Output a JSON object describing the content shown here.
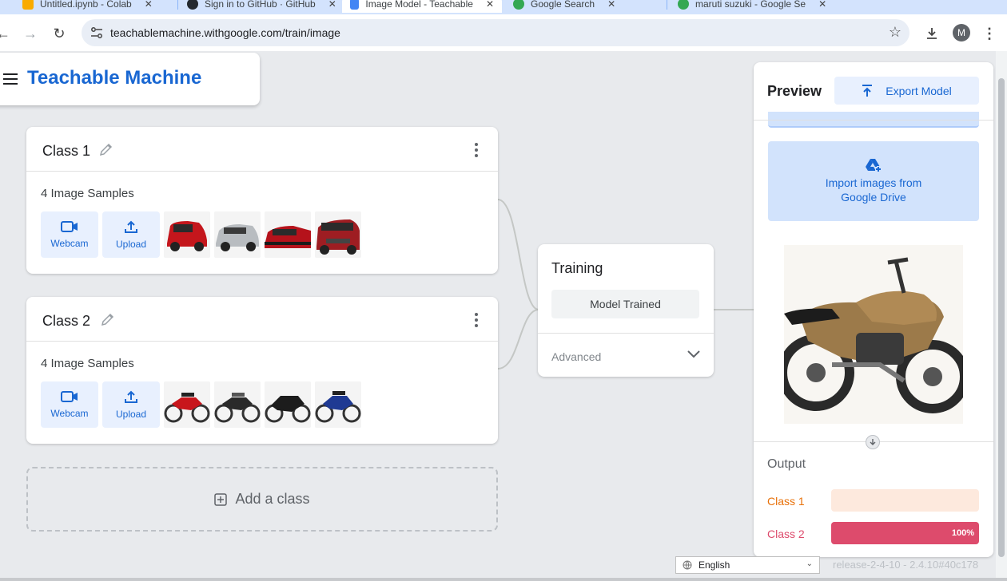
{
  "browser": {
    "tabs": [
      {
        "label": "Untitled.ipynb - Colab",
        "fav_color": "#f9ab00"
      },
      {
        "label": "Sign in to GitHub · GitHub",
        "fav_color": "#24292f"
      },
      {
        "label": "Image Model - Teachable",
        "fav_color": "#4285f4"
      },
      {
        "label": "Google Search",
        "fav_color": "#34a853"
      },
      {
        "label": "maruti suzuki - Google Se",
        "fav_color": "#34a853"
      }
    ],
    "url": "teachablemachine.withgoogle.com/train/image",
    "profile_initial": "M"
  },
  "header": {
    "brand": "Teachable Machine"
  },
  "classes": [
    {
      "name": "Class 1",
      "samples_label": "4 Image Samples",
      "webcam_label": "Webcam",
      "upload_label": "Upload"
    },
    {
      "name": "Class 2",
      "samples_label": "4 Image Samples",
      "webcam_label": "Webcam",
      "upload_label": "Upload"
    }
  ],
  "add_class_label": "Add a class",
  "training": {
    "title": "Training",
    "button_label": "Model Trained",
    "advanced_label": "Advanced"
  },
  "preview": {
    "title": "Preview",
    "export_label": "Export Model",
    "drive_label_line1": "Import images from",
    "drive_label_line2": "Google Drive",
    "output_label": "Output",
    "outputs": [
      {
        "name": "Class 1",
        "value": 0.0,
        "pct_label": "",
        "color": "#e8710a",
        "track": "#fde9dd"
      },
      {
        "name": "Class 2",
        "value": 1.0,
        "pct_label": "100%",
        "color": "#dd4b6c",
        "track": "#fce8ec"
      }
    ]
  },
  "footer": {
    "language": "English",
    "release": "release-2-4-10 - 2.4.10#40c178"
  },
  "colors": {
    "brand": "#1967d2",
    "class1": "#e8710a",
    "class2": "#dd4b6c"
  }
}
